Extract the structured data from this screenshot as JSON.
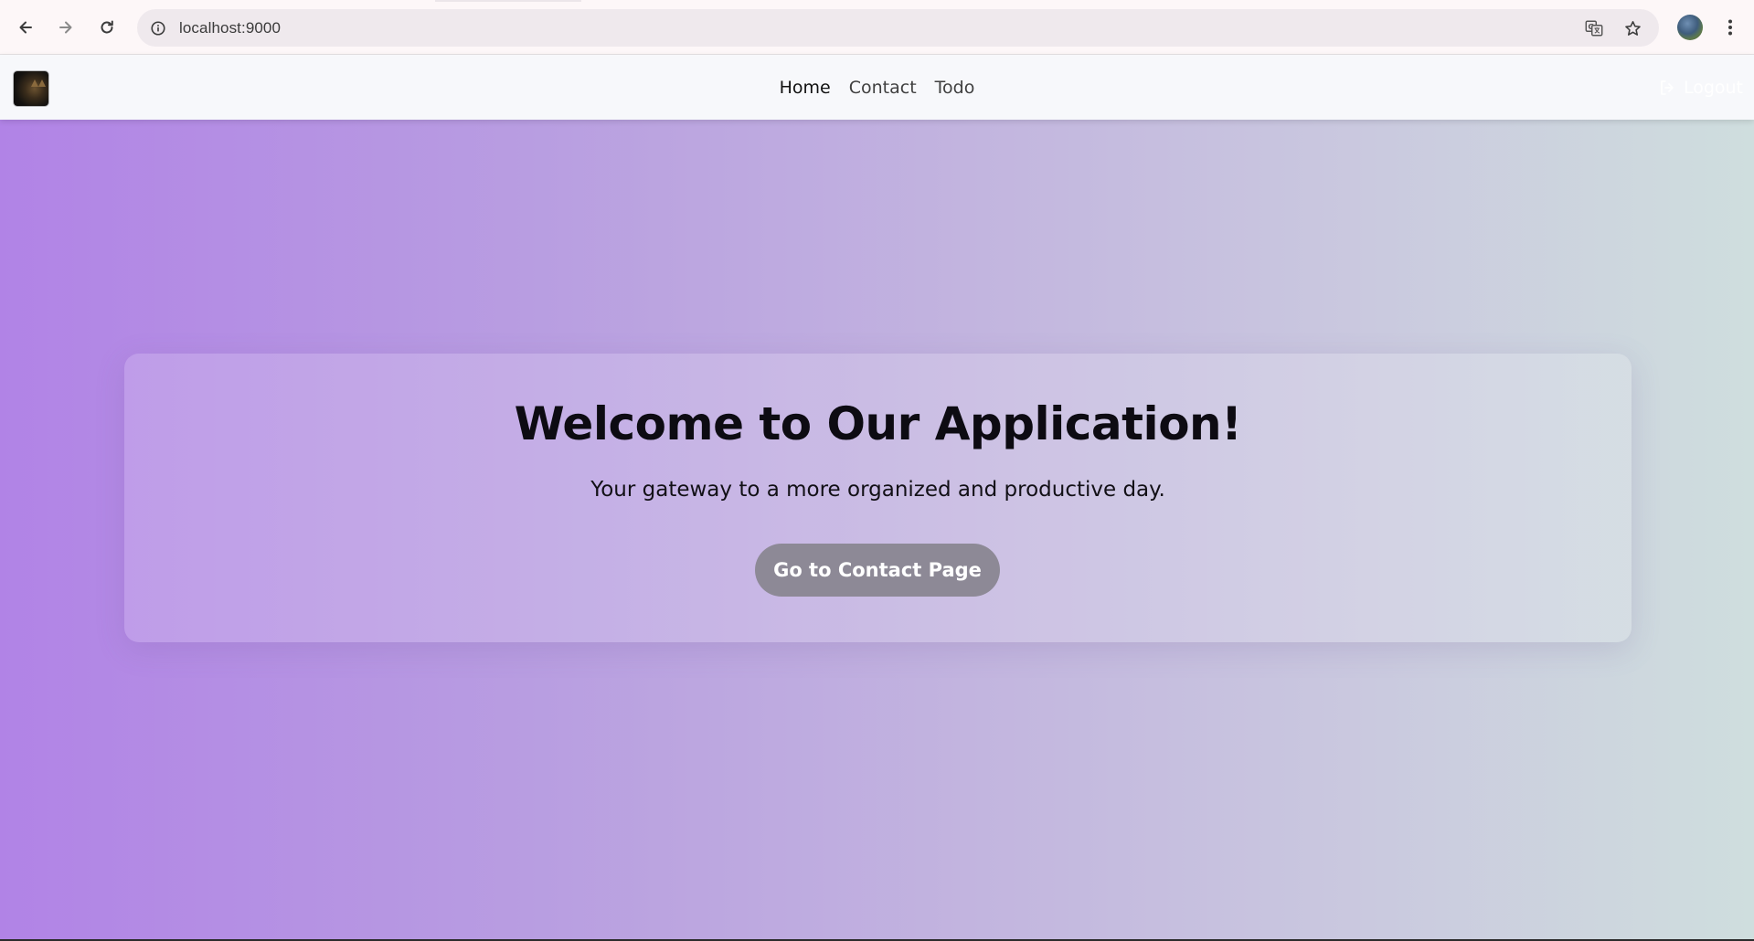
{
  "browser": {
    "url": "localhost:9000",
    "icons": {
      "back": "arrow-left-icon",
      "forward": "arrow-right-icon",
      "reload": "reload-icon",
      "site_info": "info-icon",
      "translate": "translate-icon",
      "bookmark": "star-icon",
      "profile": "avatar",
      "menu": "kebab-menu-icon"
    }
  },
  "header": {
    "nav": {
      "home": "Home",
      "contact": "Contact",
      "todo": "Todo"
    },
    "logout_label": "Logout"
  },
  "hero": {
    "title": "Welcome to Our Application!",
    "subtitle": "Your gateway to a more organized and productive day.",
    "cta_label": "Go to Contact Page"
  },
  "colors": {
    "gradient_start": "#b183e6",
    "gradient_end": "#cfdede",
    "button_bg": "#8d8996",
    "header_bg": "#f7f8fb"
  }
}
